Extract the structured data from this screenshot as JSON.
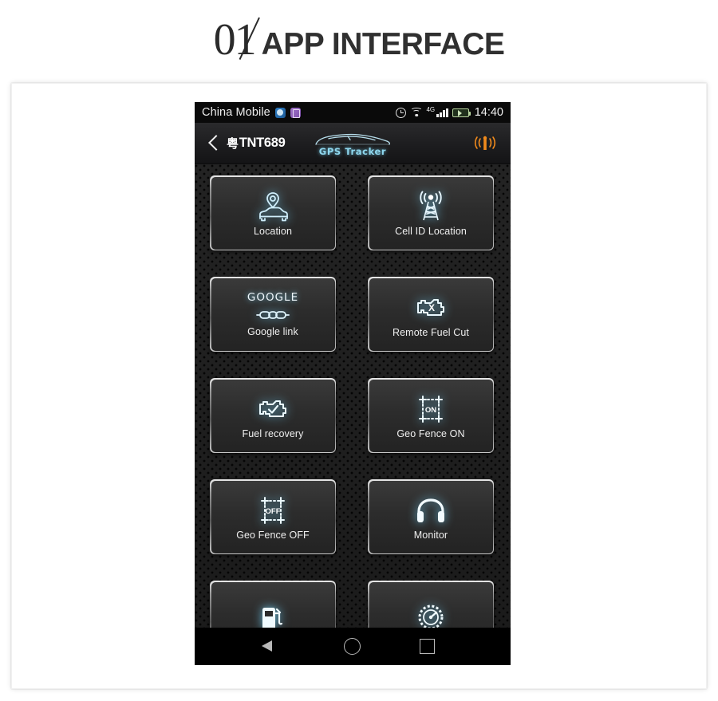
{
  "page": {
    "heading_number": "01",
    "heading_title": "APP INTERFACE"
  },
  "phone": {
    "status_bar": {
      "carrier": "China Mobile",
      "network_type": "4G",
      "time": "14:40",
      "icons": [
        "app-badge-blue",
        "app-badge-purple",
        "alarm-icon",
        "wifi-icon",
        "signal-icon",
        "battery-icon"
      ]
    },
    "app_header": {
      "back_label": "back",
      "plate_prefix": "粤",
      "plate_number": "TNT689",
      "logo_text": "GPS Tracker",
      "signal_icon": "antenna-icon",
      "accent_color": "#8fd8ef",
      "signal_color": "#f08a1c"
    },
    "tiles": [
      {
        "id": "location",
        "label": "Location",
        "icon": "car-pin-icon"
      },
      {
        "id": "cell-id",
        "label": "Cell ID Location",
        "icon": "cell-tower-icon"
      },
      {
        "id": "google-link",
        "label": "Google link",
        "icon": "chain-link-icon",
        "overline": "GOOGLE"
      },
      {
        "id": "remote-fuel-cut",
        "label": "Remote Fuel Cut",
        "icon": "engine-x-icon"
      },
      {
        "id": "fuel-recovery",
        "label": "Fuel recovery",
        "icon": "engine-check-icon"
      },
      {
        "id": "geo-fence-on",
        "label": "Geo Fence ON",
        "icon": "geofence-icon",
        "icon_text": "ON"
      },
      {
        "id": "geo-fence-off",
        "label": "Geo Fence OFF",
        "icon": "geofence-icon",
        "icon_text": "OFF"
      },
      {
        "id": "monitor",
        "label": "Monitor",
        "icon": "headphones-icon"
      },
      {
        "id": "fuel",
        "label": "",
        "icon": "fuel-pump-icon"
      },
      {
        "id": "speed",
        "label": "",
        "icon": "speedometer-icon"
      }
    ],
    "nav_bar": {
      "back": "Back",
      "home": "Home",
      "recents": "Recents"
    }
  }
}
